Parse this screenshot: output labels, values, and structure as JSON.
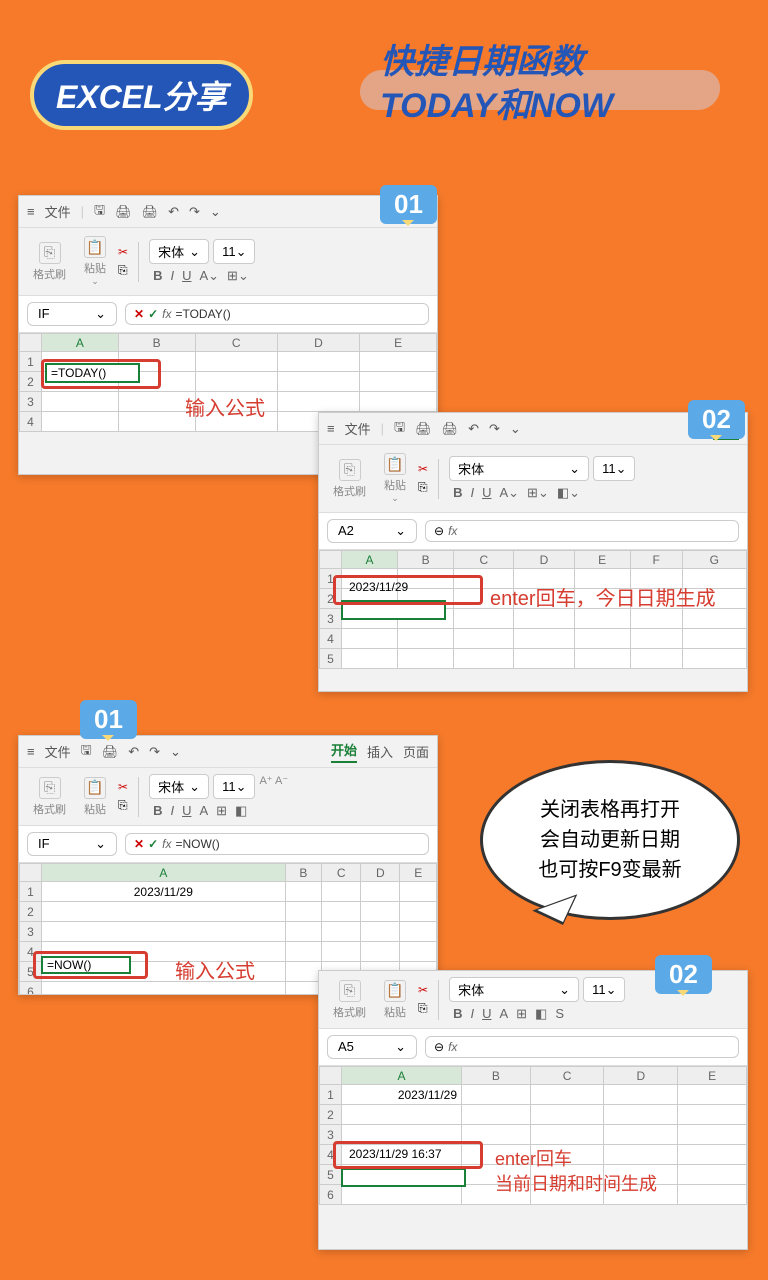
{
  "header": {
    "badge": "EXCEL分享",
    "title_line1": "快捷日期函数",
    "title_line2": "TODAY和NOW"
  },
  "steps": {
    "s1": "01",
    "s2": "02"
  },
  "ui": {
    "file": "文件",
    "start": "开始",
    "insert": "插入",
    "page": "页面",
    "format_brush": "格式刷",
    "paste": "粘贴",
    "font_name": "宋体",
    "font_size": "11",
    "bold": "B",
    "italic": "I",
    "underline": "U",
    "fx": "fx",
    "cross": "✕",
    "check": "✓",
    "chevron": "⌄",
    "scissors": "✂",
    "magnify": "⊖",
    "menu_icon": "≡",
    "save": "🖫",
    "print": "🖨",
    "undo": "↶",
    "redo": "↷"
  },
  "cols": [
    "A",
    "B",
    "C",
    "D",
    "E",
    "F",
    "G"
  ],
  "panel1": {
    "namebox": "IF",
    "formula": "=TODAY()",
    "cell_edit": "=TODAY()",
    "annot": "输入公式"
  },
  "panel2": {
    "namebox": "A2",
    "cell_val": "2023/11/29",
    "annot": "enter回车，今日日期生成"
  },
  "panel3": {
    "namebox": "IF",
    "formula": "=NOW()",
    "cell_a1": "2023/11/29",
    "cell_edit": "=NOW()",
    "annot": "输入公式"
  },
  "panel4": {
    "namebox": "A5",
    "cell_a1": "2023/11/29",
    "cell_a4": "2023/11/29 16:37",
    "annot1": "enter回车",
    "annot2": "当前日期和时间生成"
  },
  "speech": {
    "line1": "关闭表格再打开",
    "line2": "会自动更新日期",
    "line3": "也可按F9变最新"
  }
}
